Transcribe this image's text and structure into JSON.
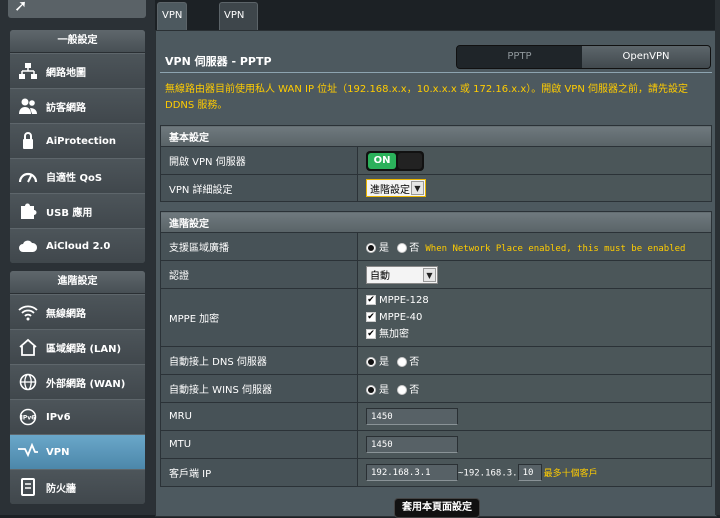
{
  "sidebar": {
    "top_icon": "arrow-icon",
    "general": {
      "header": "一般設定",
      "items": [
        {
          "label": "網路地圖",
          "icon": "network-map-icon"
        },
        {
          "label": "訪客網路",
          "icon": "guest-network-icon"
        },
        {
          "label": "AiProtection",
          "icon": "shield-lock-icon"
        },
        {
          "label": "自適性 QoS",
          "icon": "speedometer-icon"
        },
        {
          "label": "USB 應用",
          "icon": "puzzle-icon"
        },
        {
          "label": "AiCloud 2.0",
          "icon": "cloud-icon"
        }
      ]
    },
    "advanced": {
      "header": "進階設定",
      "items": [
        {
          "label": "無線網路",
          "icon": "wifi-icon"
        },
        {
          "label": "區域網路 (LAN)",
          "icon": "home-icon"
        },
        {
          "label": "外部網路 (WAN)",
          "icon": "globe-icon"
        },
        {
          "label": "IPv6",
          "icon": "ipv6-icon"
        },
        {
          "label": "VPN",
          "icon": "vpn-icon",
          "active": true
        },
        {
          "label": "防火牆",
          "icon": "firewall-icon"
        }
      ]
    }
  },
  "tabs": [
    {
      "label": "VPN 伺服器",
      "active": true
    },
    {
      "label": "VPN Client",
      "active": false
    }
  ],
  "page": {
    "title": "VPN 伺服器 - PPTP",
    "segment": {
      "left": "PPTP",
      "right": "OpenVPN",
      "selected": "OpenVPN"
    },
    "notice": "無線路由器目前使用私人 WAN IP 位址（192.168.x.x，10.x.x.x 或 172.16.x.x）。開啟 VPN 伺服器之前，請先設定 DDNS 服務。"
  },
  "basic": {
    "header": "基本設定",
    "enable_label": "開啟 VPN 伺服器",
    "enable_state": "ON",
    "detail_label": "VPN 詳細設定",
    "detail_value": "進階設定"
  },
  "advanced": {
    "header": "進階設定",
    "broadcast_label": "支援區域廣播",
    "yes": "是",
    "no": "否",
    "broadcast_note": "When Network Place enabled, this must be enabled",
    "auth_label": "認證",
    "auth_value": "自動",
    "mppe_label": "MPPE 加密",
    "mppe_options": [
      "MPPE-128",
      "MPPE-40",
      "無加密"
    ],
    "dns_label": "自動接上 DNS 伺服器",
    "wins_label": "自動接上 WINS 伺服器",
    "mru_label": "MRU",
    "mru_value": "1450",
    "mtu_label": "MTU",
    "mtu_value": "1450",
    "client_ip_label": "客戶端 IP",
    "client_ip_start": "192.168.3.1",
    "client_ip_mid": "~192.168.3.",
    "client_ip_end": "10",
    "client_ip_note": "最多十個客戶"
  },
  "apply_label": "套用本頁面設定",
  "colors": {
    "accent": "#ffcc00",
    "toggle_on": "#2bb15b",
    "active_nav": "#5b98bc"
  }
}
